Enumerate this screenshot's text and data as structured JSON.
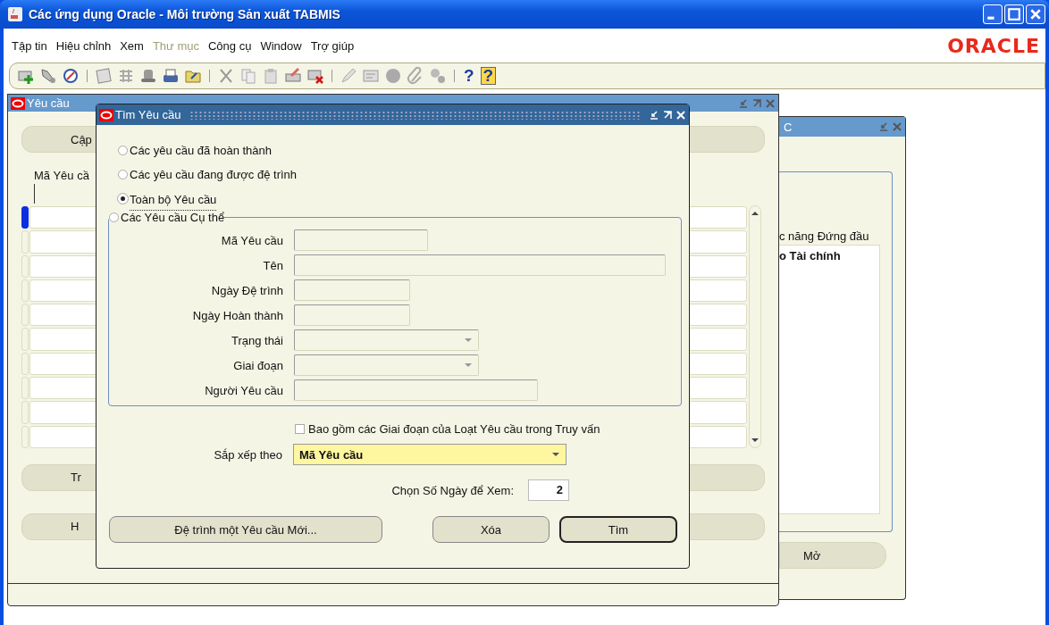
{
  "app_window": {
    "title": "Các ứng dụng Oracle -  Môi trường Sản xuất TABMIS"
  },
  "menu": [
    {
      "label": "Tập tin",
      "disabled": false
    },
    {
      "label": "Hiệu chỉnh",
      "disabled": false
    },
    {
      "label": "Xem",
      "disabled": false
    },
    {
      "label": "Thư mục",
      "disabled": true
    },
    {
      "label": "Công cụ",
      "disabled": false
    },
    {
      "label": "Window",
      "disabled": false
    },
    {
      "label": "Trợ giúp",
      "disabled": false
    }
  ],
  "logo": "ORACLE",
  "toolbar_glyphs": [
    "?",
    "?"
  ],
  "requests_window": {
    "title": "Yêu cầu",
    "top_button": "Cập",
    "column_header": "Mã Yêu cầ",
    "bottom_buttons": [
      "Tr",
      "H"
    ],
    "rows": [
      {
        "selected": true
      },
      {
        "selected": false
      },
      {
        "selected": false
      },
      {
        "selected": false
      },
      {
        "selected": false
      },
      {
        "selected": false
      },
      {
        "selected": false
      },
      {
        "selected": false
      },
      {
        "selected": false
      },
      {
        "selected": false
      }
    ]
  },
  "navigator_window": {
    "title": "C",
    "label": "c năng Đứng đầu",
    "list_items": [
      "o Tài chính"
    ],
    "button": "Mở"
  },
  "find_dialog": {
    "title": "Tìm Yêu cầu",
    "options": [
      {
        "label": "Các yêu cầu đã hoàn thành",
        "selected": false
      },
      {
        "label": "Các yêu cầu đang được đệ trình",
        "selected": false
      },
      {
        "label": "Toàn bộ Yêu cầu",
        "selected": true
      },
      {
        "label": "Các Yêu cầu Cụ thể",
        "selected": false
      }
    ],
    "fields": [
      {
        "label": "Mã Yêu cầu",
        "kind": "text"
      },
      {
        "label": "Tên",
        "kind": "text"
      },
      {
        "label": "Ngày Đệ trình",
        "kind": "text"
      },
      {
        "label": "Ngày Hoàn thành",
        "kind": "text"
      },
      {
        "label": "Trạng thái",
        "kind": "dropdown"
      },
      {
        "label": "Giai đoạn",
        "kind": "dropdown"
      },
      {
        "label": "Người Yêu cầu",
        "kind": "text"
      }
    ],
    "include_checkbox": {
      "label": "Bao gồm các Giai đoạn của Loạt Yêu cầu trong Truy vấn",
      "checked": false
    },
    "sort": {
      "label": "Sắp xếp theo",
      "value": "Mã Yêu cầu"
    },
    "days": {
      "label": "Chọn Số Ngày để Xem:",
      "value": "2"
    },
    "buttons": [
      {
        "label": "Đệ trình một Yêu cầu Mới...",
        "default": false
      },
      {
        "label": "Xóa",
        "default": false
      },
      {
        "label": "Tìm",
        "default": true
      }
    ]
  }
}
